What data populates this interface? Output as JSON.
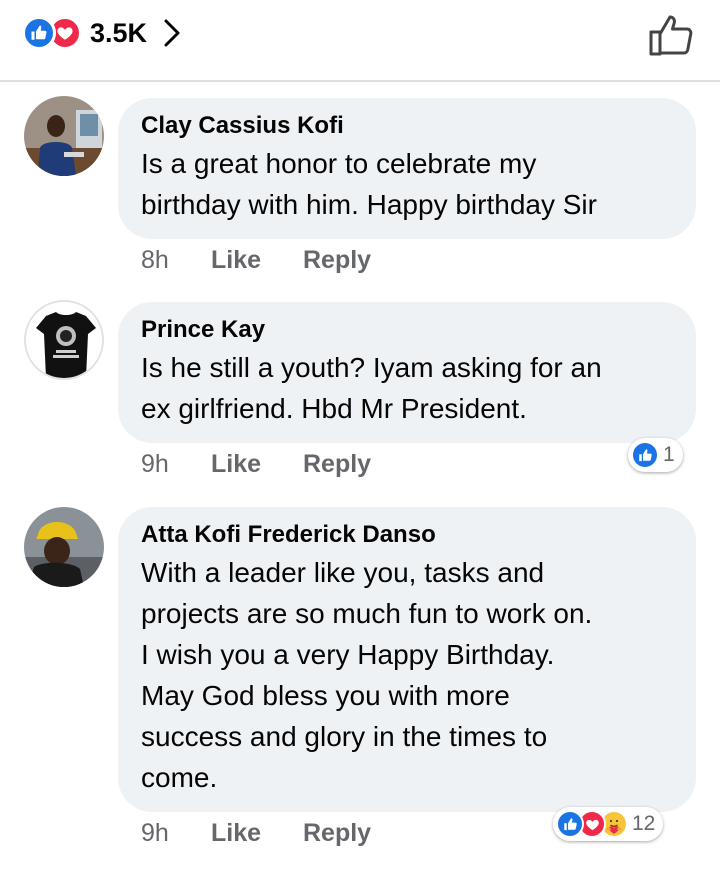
{
  "header": {
    "reaction_count": "3.5K",
    "reaction_icons": [
      "like-icon",
      "love-icon"
    ],
    "colors": {
      "like": "#1b74e4",
      "love": "#f0284a",
      "divider": "#dcdfe3"
    }
  },
  "comments": [
    {
      "author": "Clay Cassius Kofi",
      "lines": [
        "Is a great honor to celebrate my",
        "birthday with him. Happy birthday Sir"
      ],
      "time": "8h",
      "like_label": "Like",
      "reply_label": "Reply"
    },
    {
      "author": "Prince Kay",
      "lines": [
        "Is he still a youth? Iyam asking for an",
        "ex girlfriend. Hbd Mr President."
      ],
      "time": "9h",
      "like_label": "Like",
      "reply_label": "Reply",
      "reactions": {
        "icons": [
          "like-icon"
        ],
        "count": "1"
      }
    },
    {
      "author": "Atta Kofi Frederick Danso",
      "lines": [
        "With a leader like you, tasks and",
        "projects are so much fun to work on.",
        "I wish you a very Happy Birthday.",
        "May God bless you with more",
        "success and glory in the times to",
        "come."
      ],
      "time": "9h",
      "like_label": "Like",
      "reply_label": "Reply",
      "reactions": {
        "icons": [
          "like-icon",
          "love-icon",
          "care-icon"
        ],
        "count": "12"
      }
    }
  ]
}
